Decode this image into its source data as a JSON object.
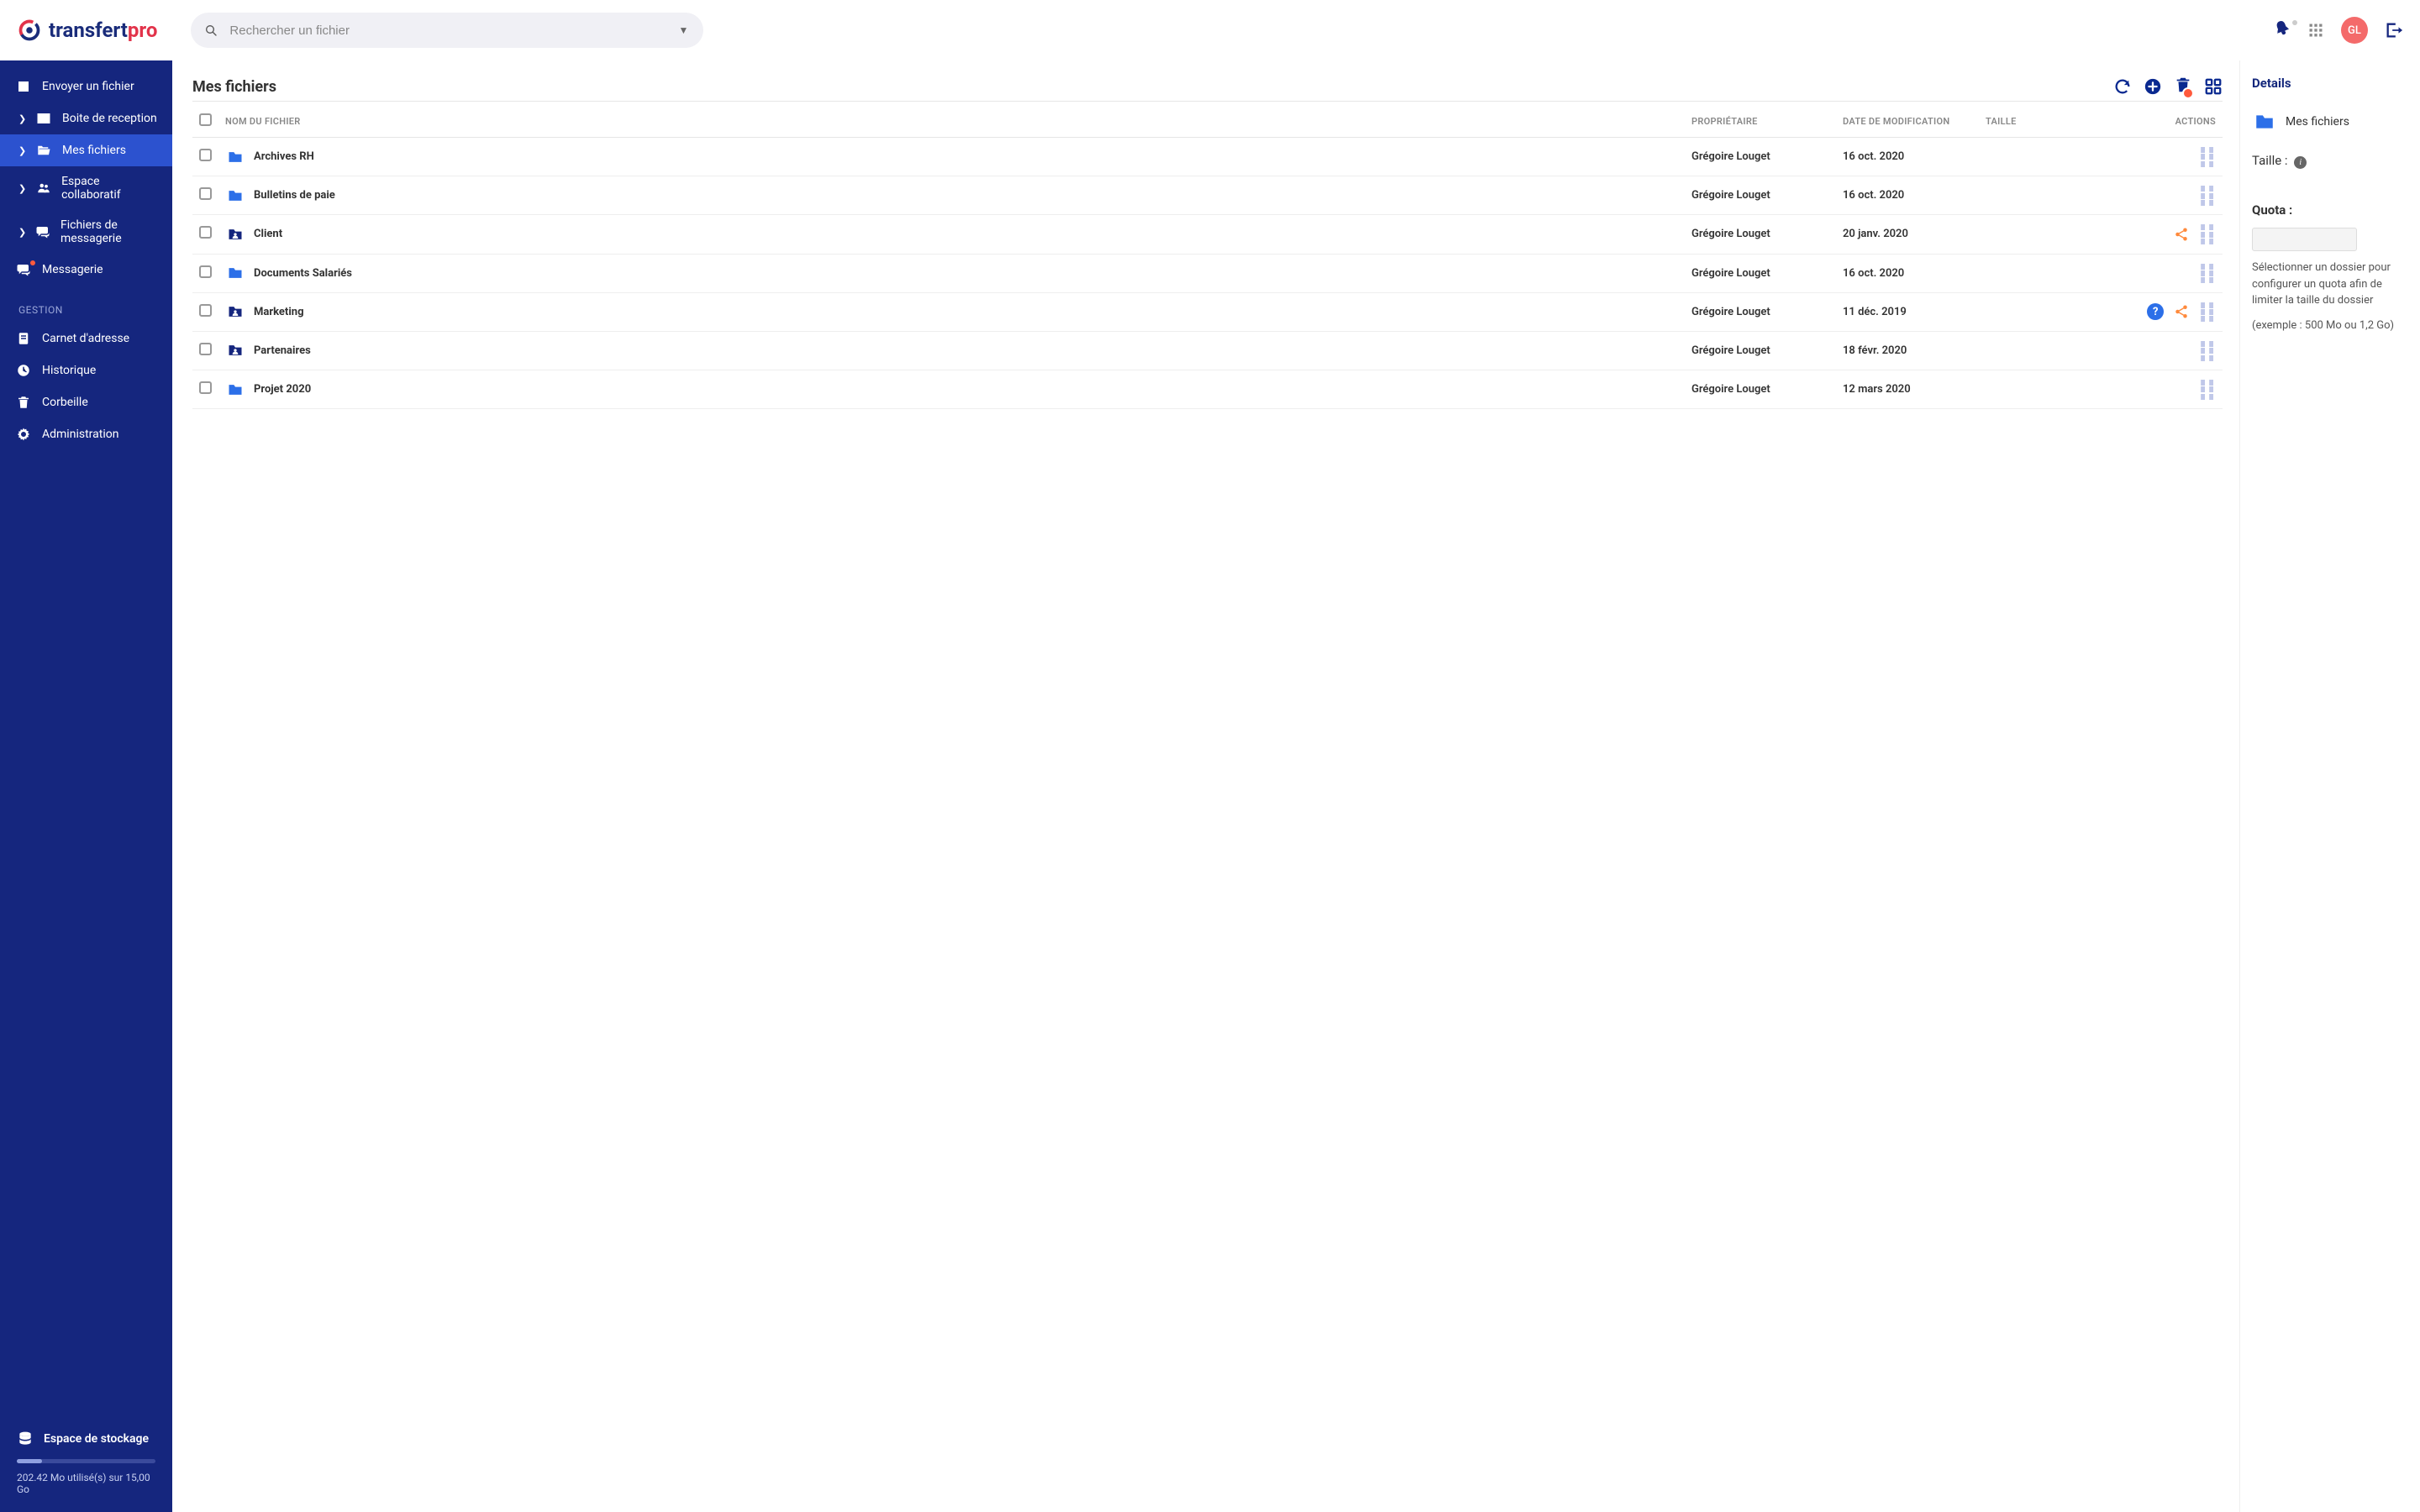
{
  "brand": {
    "part1": "transfert",
    "part2": "pro"
  },
  "search": {
    "placeholder": "Rechercher un fichier"
  },
  "topbar": {
    "avatar_initials": "GL"
  },
  "sidebar": {
    "items": [
      {
        "label": "Envoyer un fichier"
      },
      {
        "label": "Boite de reception"
      },
      {
        "label": "Mes fichiers"
      },
      {
        "label": "Espace collaboratif"
      },
      {
        "label": "Fichiers de messagerie"
      },
      {
        "label": "Messagerie"
      }
    ],
    "group_title": "GESTION",
    "group_items": [
      {
        "label": "Carnet d'adresse"
      },
      {
        "label": "Historique"
      },
      {
        "label": "Corbeille"
      },
      {
        "label": "Administration"
      }
    ],
    "storage": {
      "title": "Espace de stockage",
      "text": "202.42 Mo utilisé(s) sur 15,00 Go"
    }
  },
  "page": {
    "title": "Mes fichiers",
    "columns": {
      "name": "NOM DU FICHIER",
      "owner": "PROPRIÉTAIRE",
      "modified": "DATE DE MODIFICATION",
      "size": "TAILLE",
      "actions": "ACTIONS"
    }
  },
  "files": [
    {
      "name": "Archives RH",
      "owner": "Grégoire Louget",
      "modified": "16 oct. 2020",
      "size": "",
      "shared": false,
      "help": false,
      "folder_type": "plain"
    },
    {
      "name": "Bulletins de paie",
      "owner": "Grégoire Louget",
      "modified": "16 oct. 2020",
      "size": "",
      "shared": false,
      "help": false,
      "folder_type": "plain"
    },
    {
      "name": "Client",
      "owner": "Grégoire Louget",
      "modified": "20 janv. 2020",
      "size": "",
      "shared": true,
      "help": false,
      "folder_type": "user"
    },
    {
      "name": "Documents Salariés",
      "owner": "Grégoire Louget",
      "modified": "16 oct. 2020",
      "size": "",
      "shared": false,
      "help": false,
      "folder_type": "plain"
    },
    {
      "name": "Marketing",
      "owner": "Grégoire Louget",
      "modified": "11 déc. 2019",
      "size": "",
      "shared": true,
      "help": true,
      "folder_type": "user"
    },
    {
      "name": "Partenaires",
      "owner": "Grégoire Louget",
      "modified": "18 févr. 2020",
      "size": "",
      "shared": false,
      "help": false,
      "folder_type": "user"
    },
    {
      "name": "Projet 2020",
      "owner": "Grégoire Louget",
      "modified": "12 mars 2020",
      "size": "",
      "shared": false,
      "help": false,
      "folder_type": "plain"
    }
  ],
  "details": {
    "title": "Details",
    "folder_name": "Mes fichiers",
    "size_label": "Taille :",
    "quota_label": "Quota :",
    "quota_help1": "Sélectionner un dossier pour configurer un quota afin de limiter la taille du dossier",
    "quota_help2": "(exemple : 500 Mo ou 1,2 Go)"
  }
}
